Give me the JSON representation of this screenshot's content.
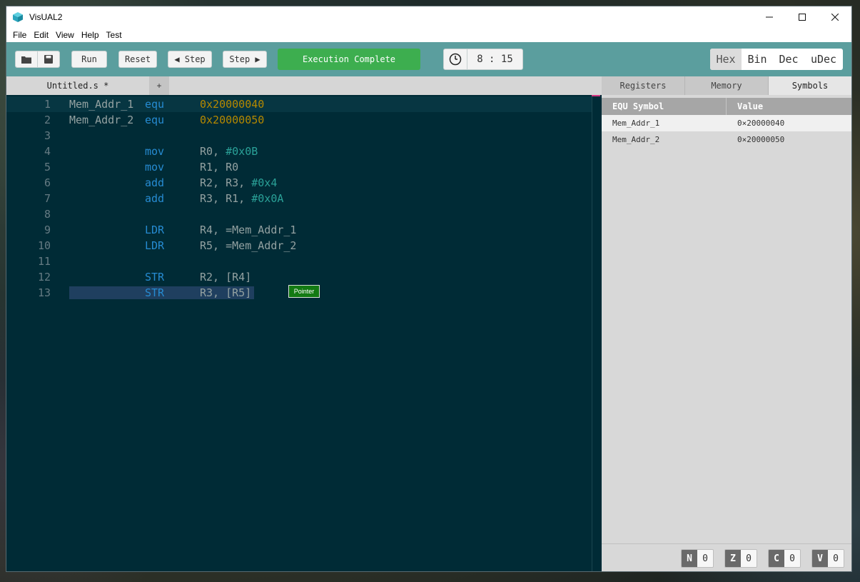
{
  "window": {
    "title": "VisUAL2"
  },
  "menu": [
    "File",
    "Edit",
    "View",
    "Help",
    "Test"
  ],
  "toolbar": {
    "run": "Run",
    "reset": "Reset",
    "step_back": "◀ Step",
    "step_forward": "Step ▶",
    "status": "Execution Complete",
    "clock": "8 : 15",
    "bases": [
      "Hex",
      "Bin",
      "Dec",
      "uDec"
    ],
    "active_base": "Hex"
  },
  "editor": {
    "tab_name": "Untitled.s *",
    "add_tab": "+",
    "lines": [
      {
        "n": "1",
        "label": "Mem_Addr_1",
        "op": "equ",
        "args": [
          {
            "t": "0x20000040",
            "k": "num"
          }
        ]
      },
      {
        "n": "2",
        "label": "Mem_Addr_2",
        "op": "equ",
        "args": [
          {
            "t": "0x20000050",
            "k": "num"
          }
        ]
      },
      {
        "n": "3",
        "label": "",
        "op": "",
        "args": []
      },
      {
        "n": "4",
        "label": "",
        "op": "mov",
        "args": [
          {
            "t": "R0, ",
            "k": "reg"
          },
          {
            "t": "#0x0B",
            "k": "imm"
          }
        ]
      },
      {
        "n": "5",
        "label": "",
        "op": "mov",
        "args": [
          {
            "t": "R1, R0",
            "k": "reg"
          }
        ]
      },
      {
        "n": "6",
        "label": "",
        "op": "add",
        "args": [
          {
            "t": "R2, R3, ",
            "k": "reg"
          },
          {
            "t": "#0x4",
            "k": "imm"
          }
        ]
      },
      {
        "n": "7",
        "label": "",
        "op": "add",
        "args": [
          {
            "t": "R3, R1, ",
            "k": "reg"
          },
          {
            "t": "#0x0A",
            "k": "imm"
          }
        ]
      },
      {
        "n": "8",
        "label": "",
        "op": "",
        "args": []
      },
      {
        "n": "9",
        "label": "",
        "op": "LDR",
        "args": [
          {
            "t": "R4, =Mem_Addr_1",
            "k": "reg"
          }
        ]
      },
      {
        "n": "10",
        "label": "",
        "op": "LDR",
        "args": [
          {
            "t": "R5, =Mem_Addr_2",
            "k": "reg"
          }
        ]
      },
      {
        "n": "11",
        "label": "",
        "op": "",
        "args": []
      },
      {
        "n": "12",
        "label": "",
        "op": "STR",
        "args": [
          {
            "t": "R2, [R4]",
            "k": "reg"
          }
        ]
      },
      {
        "n": "13",
        "label": "",
        "op": "STR",
        "args": [
          {
            "t": "R3, [R5]",
            "k": "reg"
          }
        ]
      }
    ],
    "pointer_badge": "Pointer"
  },
  "side_panel": {
    "tabs": [
      "Registers",
      "Memory",
      "Symbols"
    ],
    "active_tab": "Symbols",
    "headers": [
      "EQU Symbol",
      "Value"
    ],
    "symbols": [
      {
        "name": "Mem_Addr_1",
        "value": "0×20000040"
      },
      {
        "name": "Mem_Addr_2",
        "value": "0×20000050"
      }
    ],
    "flags": [
      {
        "name": "N",
        "value": "0"
      },
      {
        "name": "Z",
        "value": "0"
      },
      {
        "name": "C",
        "value": "0"
      },
      {
        "name": "V",
        "value": "0"
      }
    ]
  }
}
